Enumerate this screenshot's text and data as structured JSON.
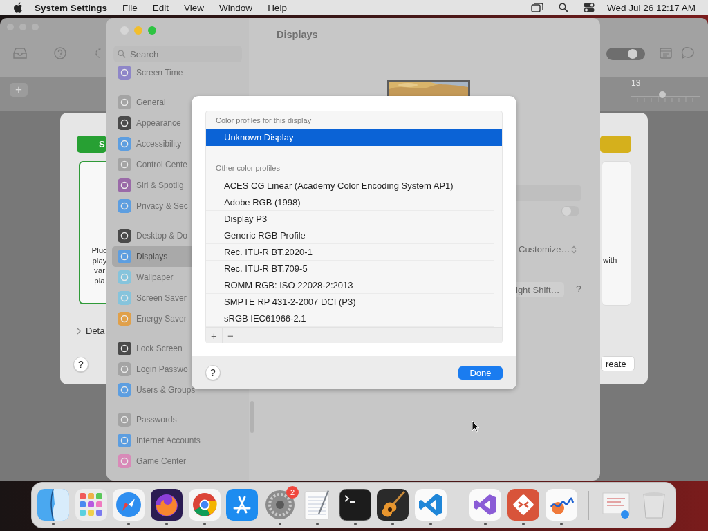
{
  "menu_bar": {
    "app_name": "System Settings",
    "menus": [
      "File",
      "Edit",
      "View",
      "Window",
      "Help"
    ],
    "clock": "Wed Jul 26  12:17 AM"
  },
  "back_window": {
    "add_button": "+",
    "ruler_number": "13",
    "slider": {
      "level": 0.46
    }
  },
  "card": {
    "green_button": "S",
    "plug_lines": [
      "Plug",
      "play",
      "var",
      "pia"
    ],
    "details": "Deta",
    "help": "?",
    "right_text": "with",
    "create_button": "reate"
  },
  "settings": {
    "title": "Displays",
    "search": {
      "placeholder": "Search"
    },
    "sidebar": {
      "groups": [
        {
          "items": [
            {
              "label": "Screen Time",
              "color": "#8e86c8",
              "selected": false
            }
          ]
        },
        {
          "items": [
            {
              "label": "General",
              "color": "#a4a4a4",
              "selected": false
            },
            {
              "label": "Appearance",
              "color": "#4a4a4a",
              "selected": false
            },
            {
              "label": "Accessibility",
              "color": "#5d9ee0",
              "selected": false
            },
            {
              "label": "Control Cente",
              "color": "#a4a4a4",
              "selected": false
            },
            {
              "label": "Siri & Spotlig",
              "color": "#9a6aa8",
              "selected": false
            },
            {
              "label": "Privacy & Sec",
              "color": "#5d9ee0",
              "selected": false
            }
          ]
        },
        {
          "items": [
            {
              "label": "Desktop & Do",
              "color": "#4a4a4a",
              "selected": false
            },
            {
              "label": "Displays",
              "color": "#5d9ee0",
              "selected": true
            },
            {
              "label": "Wallpaper",
              "color": "#86c4dc",
              "selected": false
            },
            {
              "label": "Screen Saver",
              "color": "#86c4dc",
              "selected": false
            },
            {
              "label": "Energy Saver",
              "color": "#e0a04a",
              "selected": false
            }
          ]
        },
        {
          "items": [
            {
              "label": "Lock Screen",
              "color": "#4a4a4a",
              "selected": false
            },
            {
              "label": "Login Passwo",
              "color": "#a4a4a4",
              "selected": false
            },
            {
              "label": "Users & Groups",
              "color": "#5d9ee0",
              "selected": false
            }
          ]
        },
        {
          "items": [
            {
              "label": "Passwords",
              "color": "#a4a4a4",
              "selected": false
            },
            {
              "label": "Internet Accounts",
              "color": "#5d9ee0",
              "selected": false
            },
            {
              "label": "Game Center",
              "color": "#d88ab8",
              "selected": false
            }
          ]
        }
      ]
    },
    "content": {
      "toggle_on": false,
      "customize": "Customize…",
      "night_shift": "ight Shift…",
      "help": "?"
    }
  },
  "dialog": {
    "section_1": "Color profiles for this display",
    "display_profiles": [
      {
        "label": "Unknown Display",
        "selected": true
      }
    ],
    "section_2": "Other color profiles",
    "other_profiles": [
      {
        "label": "ACES CG Linear (Academy Color Encoding System AP1)",
        "selected": false
      },
      {
        "label": "Adobe RGB (1998)",
        "selected": false
      },
      {
        "label": "Display P3",
        "selected": false
      },
      {
        "label": "Generic RGB Profile",
        "selected": false
      },
      {
        "label": "Rec. ITU-R BT.2020-1",
        "selected": false
      },
      {
        "label": "Rec. ITU-R BT.709-5",
        "selected": false
      },
      {
        "label": "ROMM RGB: ISO 22028-2:2013",
        "selected": false
      },
      {
        "label": "SMPTE RP 431-2-2007 DCI (P3)",
        "selected": false
      },
      {
        "label": "sRGB IEC61966-2.1",
        "selected": false
      }
    ],
    "add_button": "+",
    "remove_button": "−",
    "help": "?",
    "done_button": "Done"
  },
  "dock": {
    "items": [
      {
        "kind": "finder",
        "running": true
      },
      {
        "kind": "launchpad",
        "running": false
      },
      {
        "kind": "safari",
        "running": true
      },
      {
        "kind": "firefox",
        "running": true
      },
      {
        "kind": "chrome",
        "running": true
      },
      {
        "kind": "appstore",
        "running": false
      },
      {
        "kind": "settings",
        "running": true,
        "badge": "2"
      },
      {
        "kind": "textedit",
        "running": true
      },
      {
        "kind": "terminal",
        "running": true
      },
      {
        "kind": "guitar",
        "running": true
      },
      {
        "kind": "vscode",
        "running": true
      },
      {
        "kind": "divider"
      },
      {
        "kind": "vstudio",
        "running": true
      },
      {
        "kind": "remote",
        "running": true
      },
      {
        "kind": "freeform",
        "running": true
      },
      {
        "kind": "divider"
      },
      {
        "kind": "document",
        "running": false
      },
      {
        "kind": "trash",
        "running": false
      }
    ]
  }
}
